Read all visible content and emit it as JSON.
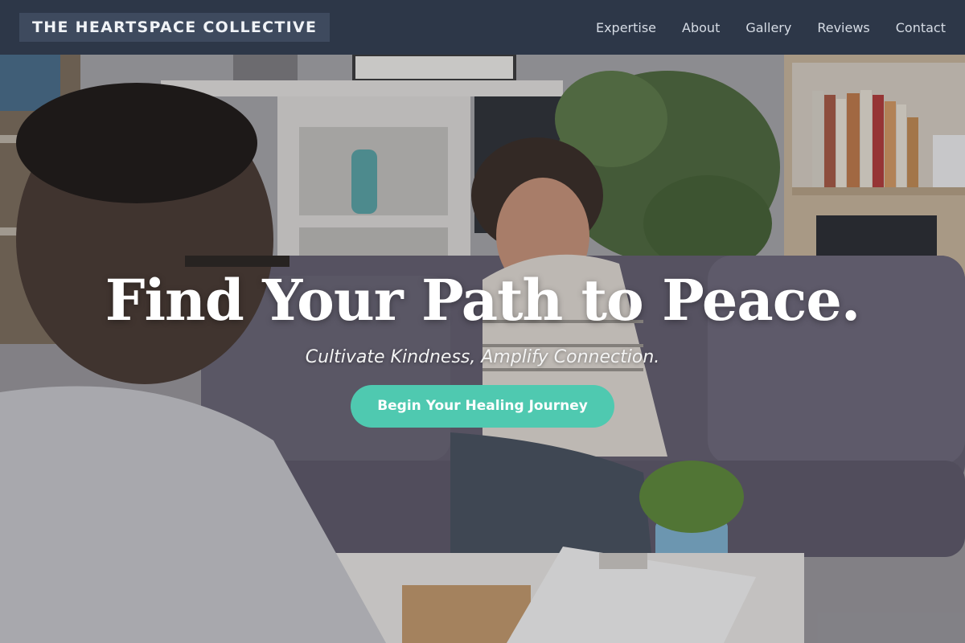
{
  "brand": {
    "name": "THE HEARTSPACE COLLECTIVE"
  },
  "nav": {
    "items": [
      {
        "label": "Expertise"
      },
      {
        "label": "About"
      },
      {
        "label": "Gallery"
      },
      {
        "label": "Reviews"
      },
      {
        "label": "Contact"
      }
    ]
  },
  "hero": {
    "title": "Find Your Path to Peace.",
    "subtitle": "Cultivate Kindness, Amplify Connection.",
    "cta_label": "Begin Your Healing Journey",
    "background_image": "therapy-session-photo"
  },
  "colors": {
    "nav_bg": "#2d3748",
    "logo_bg": "#3e4a5e",
    "accent": "#4fc9b0"
  }
}
